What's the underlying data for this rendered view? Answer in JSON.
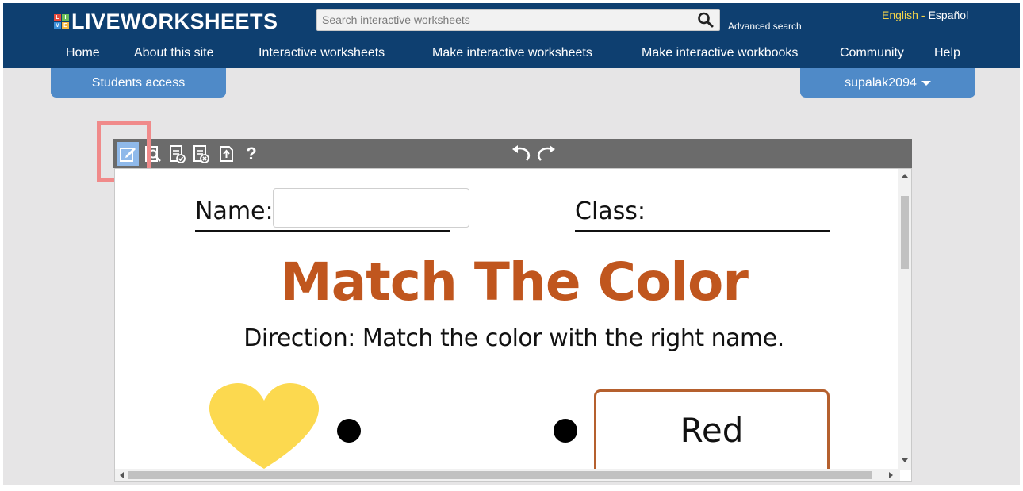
{
  "colors": {
    "header": "#0e3f70",
    "tab": "#4f8ac8",
    "accent_lang": "#f4d44a",
    "title": "#c0561e",
    "highlight": "#f08a8a"
  },
  "header": {
    "logo_letters": [
      "L",
      "I",
      "V",
      "E"
    ],
    "logo_text": "LIVEWORKSHEETS",
    "search_placeholder": "Search interactive worksheets",
    "advanced_search": "Advanced search",
    "lang_english": "English",
    "lang_sep": "-",
    "lang_spanish": "Español"
  },
  "nav": {
    "home": "Home",
    "about": "About this site",
    "interactive": "Interactive worksheets",
    "make_worksheets": "Make interactive worksheets",
    "make_workbooks": "Make interactive workbooks",
    "community": "Community",
    "help": "Help"
  },
  "tabs": {
    "students": "Students access",
    "user": "supalak2094"
  },
  "toolbar": {
    "icons": [
      "edit-icon",
      "preview-icon",
      "check-icon",
      "clear-icon",
      "export-icon",
      "help-icon",
      "undo-icon",
      "redo-icon"
    ],
    "help_label": "?"
  },
  "worksheet": {
    "name_label": "Name:",
    "class_label": "Class:",
    "title": "Match The Color",
    "direction": "Direction: Match the color with the right name.",
    "color_name": "Red",
    "heart_color": "#fcd94f"
  }
}
